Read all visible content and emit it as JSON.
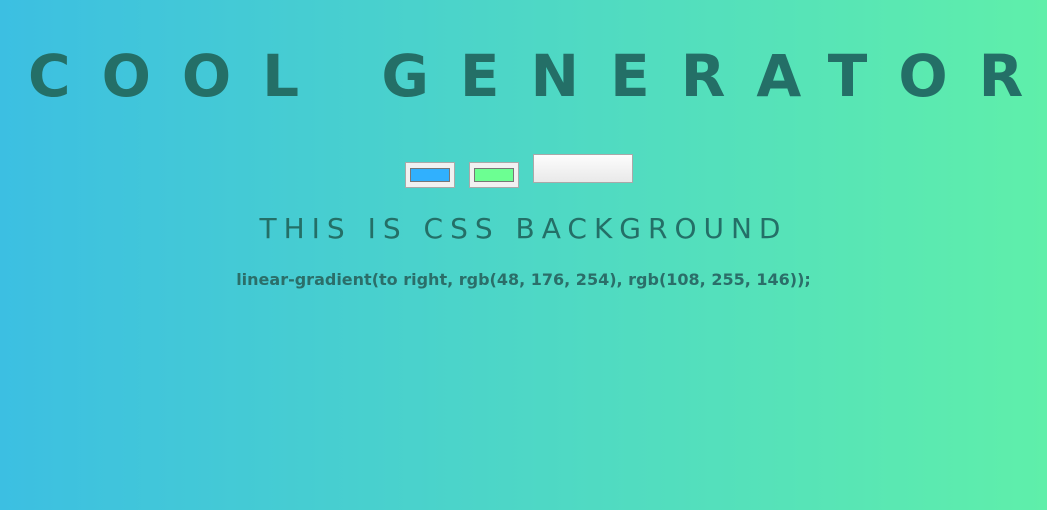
{
  "header": {
    "title": "COOL GENERATOR"
  },
  "controls": {
    "color1": "#30b0fe",
    "color2": "#6cff92",
    "button_label": ""
  },
  "main": {
    "subtitle": "THIS IS CSS BACKGROUND",
    "css_output": "linear-gradient(to right, rgb(48, 176, 254), rgb(108, 255, 146));"
  }
}
